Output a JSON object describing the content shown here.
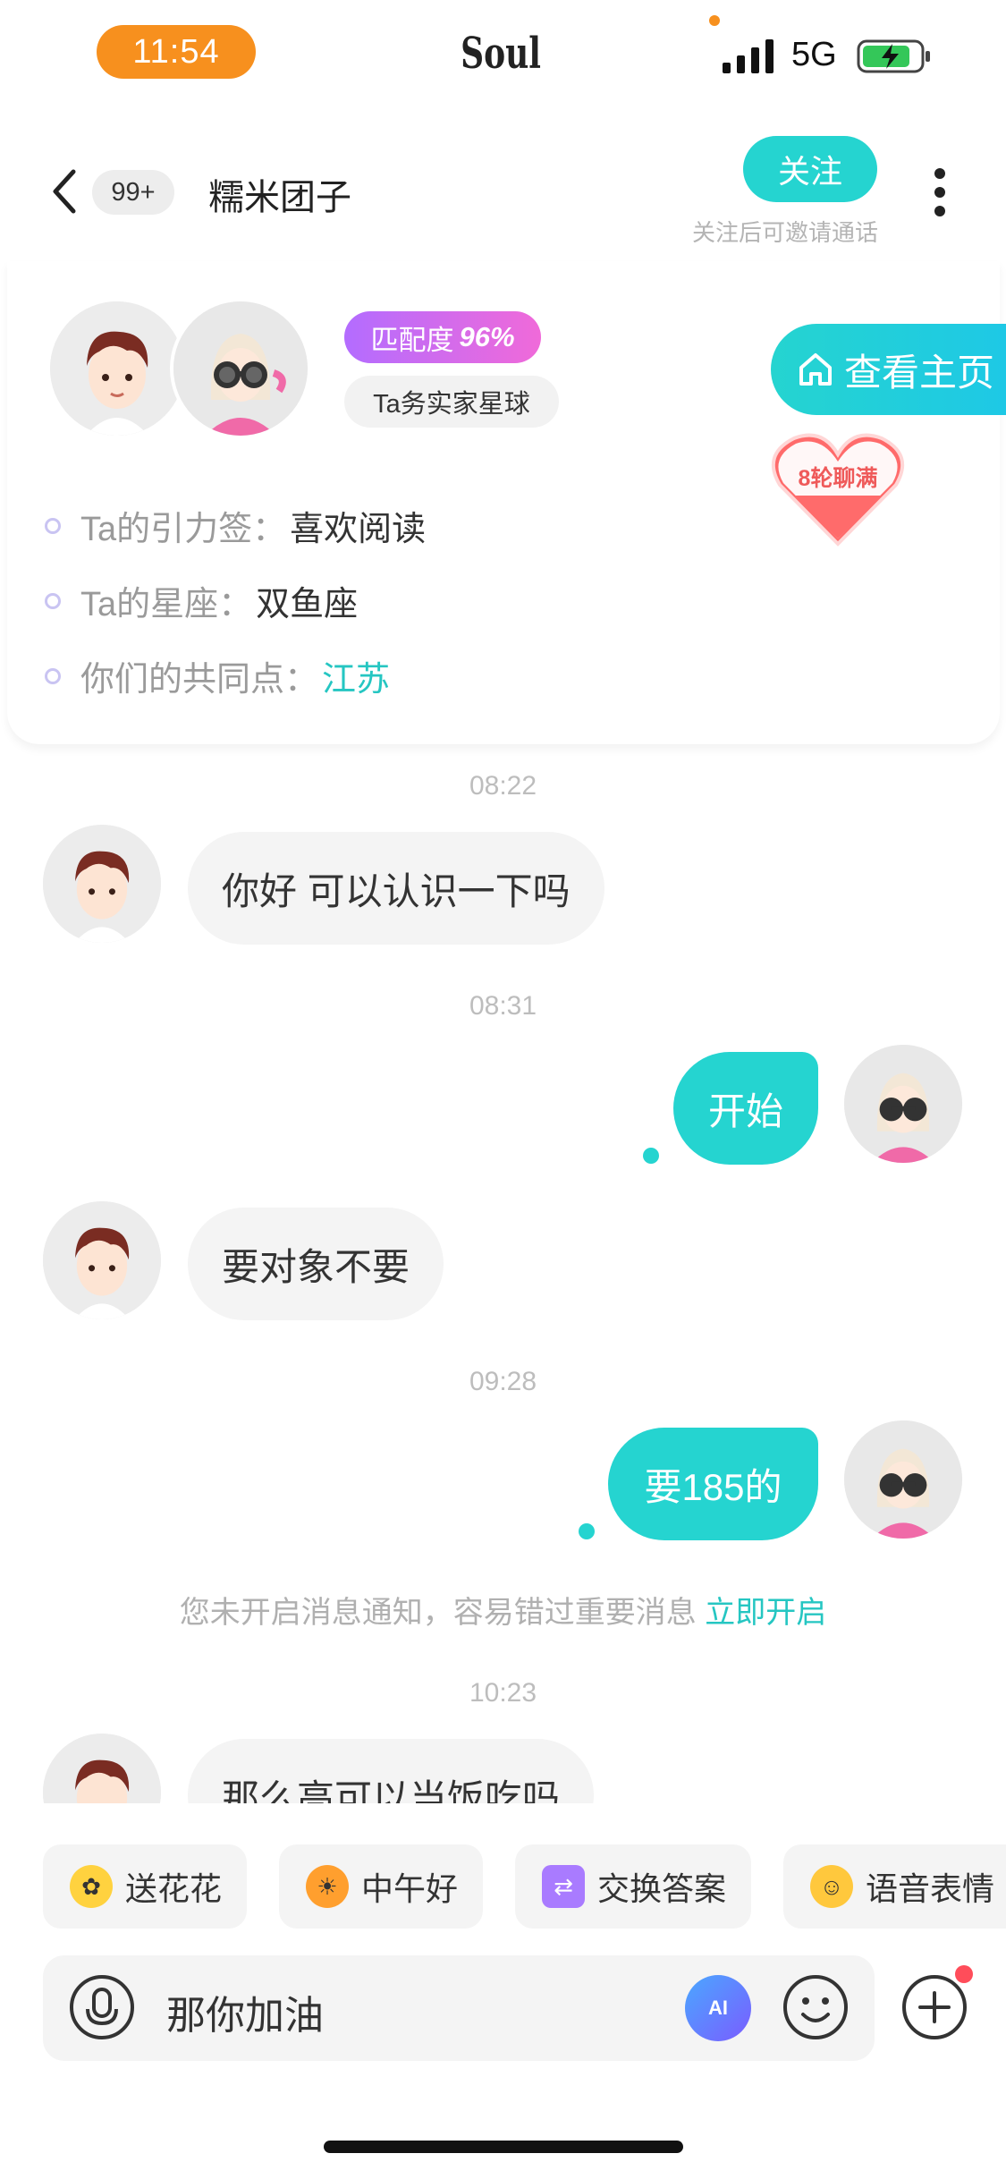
{
  "status_bar": {
    "time": "11:54",
    "app_name": "Soul",
    "network": "5G",
    "signal_icon": "signal-bars-icon",
    "battery_icon": "battery-charging-icon"
  },
  "header": {
    "unread_badge": "99+",
    "title": "糯米团子",
    "follow_label": "关注",
    "follow_hint": "关注后可邀请通话"
  },
  "profile": {
    "match_label": "匹配度",
    "match_value": "96%",
    "planet": "Ta务实家星球",
    "view_home": "查看主页",
    "chat_rounds": "8轮聊满",
    "info": [
      {
        "label": "Ta的引力签：",
        "value": "喜欢阅读"
      },
      {
        "label": "Ta的星座：",
        "value": "双鱼座"
      },
      {
        "label": "你们的共同点：",
        "value": "江苏"
      }
    ]
  },
  "messages": [
    {
      "time": "08:22",
      "from": "them",
      "text": "你好 可以认识一下吗"
    },
    {
      "time": "08:31",
      "from": "me",
      "text": "开始"
    },
    {
      "from": "them",
      "text": "要对象不要"
    },
    {
      "time": "09:28",
      "from": "me",
      "text": "要185的"
    },
    {
      "time": "10:23",
      "from": "them",
      "text": "那么高可以当饭吃吗"
    }
  ],
  "notice": {
    "text": "您未开启消息通知，容易错过重要消息",
    "action": "立即开启"
  },
  "quick_actions": [
    {
      "label": "送花花",
      "icon": "flower-emoji-icon"
    },
    {
      "label": "中午好",
      "icon": "sun-sunglasses-emoji-icon"
    },
    {
      "label": "交换答案",
      "icon": "exchange-icon"
    },
    {
      "label": "语音表情",
      "icon": "voice-emoji-icon"
    }
  ],
  "input": {
    "value": "那你加油",
    "ai_label": "AI"
  },
  "colors": {
    "accent": "#25d4d0",
    "orange": "#f7901e"
  }
}
